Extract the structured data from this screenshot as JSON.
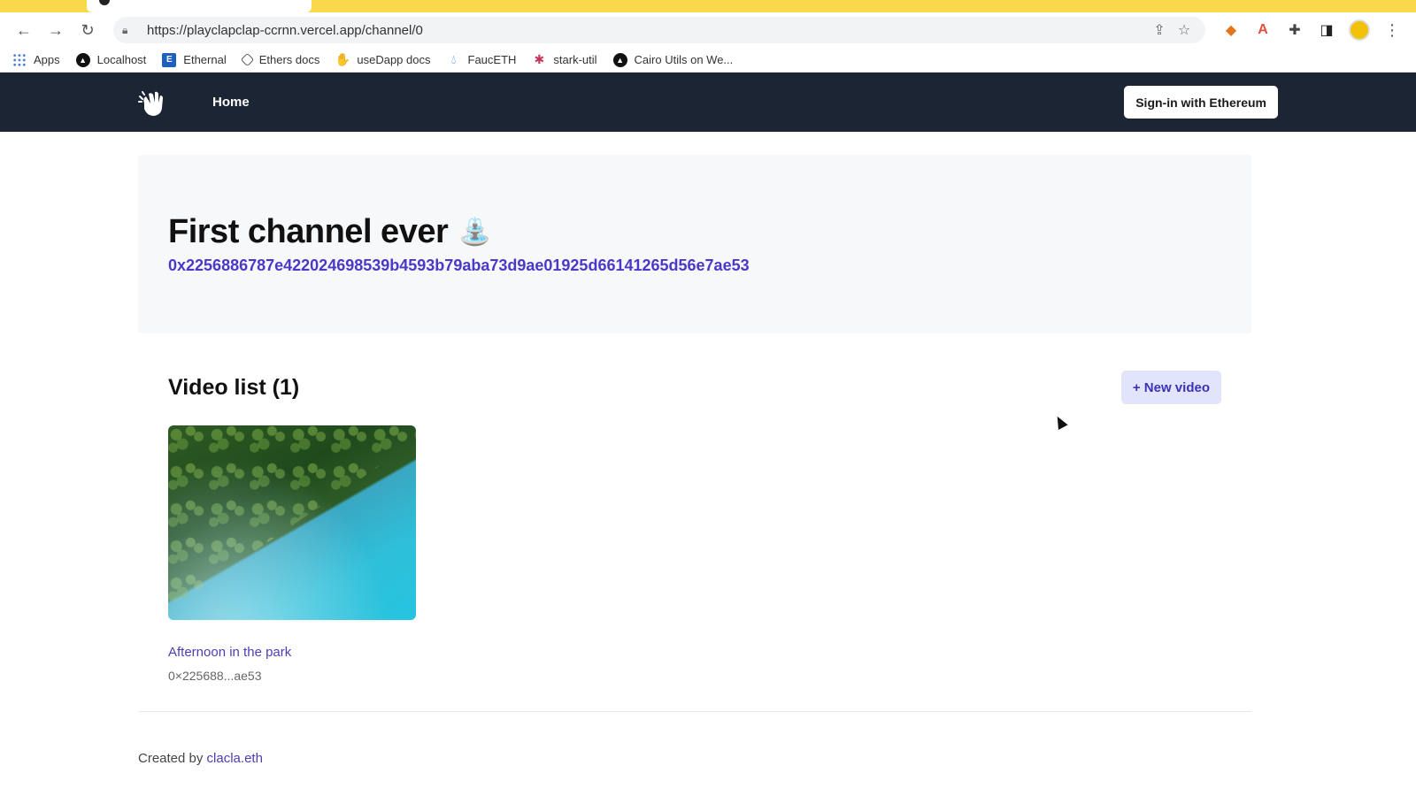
{
  "browser": {
    "url": "https://playclapclap-ccrnn.vercel.app/channel/0",
    "bookmarks": [
      {
        "label": "Apps"
      },
      {
        "label": "Localhost"
      },
      {
        "label": "Ethernal"
      },
      {
        "label": "Ethers docs"
      },
      {
        "label": "useDapp docs"
      },
      {
        "label": "FaucETH"
      },
      {
        "label": "stark-util"
      },
      {
        "label": "Cairo Utils on We..."
      }
    ]
  },
  "header": {
    "home_label": "Home",
    "signin_label": "Sign-in with Ethereum"
  },
  "hero": {
    "title": "First channel ever",
    "emoji": "⛲",
    "address": "0x2256886787e422024698539b4593b79aba73d9ae01925d66141265d56e7ae53"
  },
  "video_list": {
    "title": "Video list (1)",
    "new_video_label": "+ New video",
    "items": [
      {
        "title": "Afternoon in the park",
        "owner": "0×225688...ae53"
      }
    ]
  },
  "footer": {
    "prefix": "Created by ",
    "author": "clacla.eth"
  },
  "colors": {
    "header_bg": "#1c2533",
    "accent": "#4a39c8",
    "chrome_tabstrip": "#fbd84a"
  }
}
